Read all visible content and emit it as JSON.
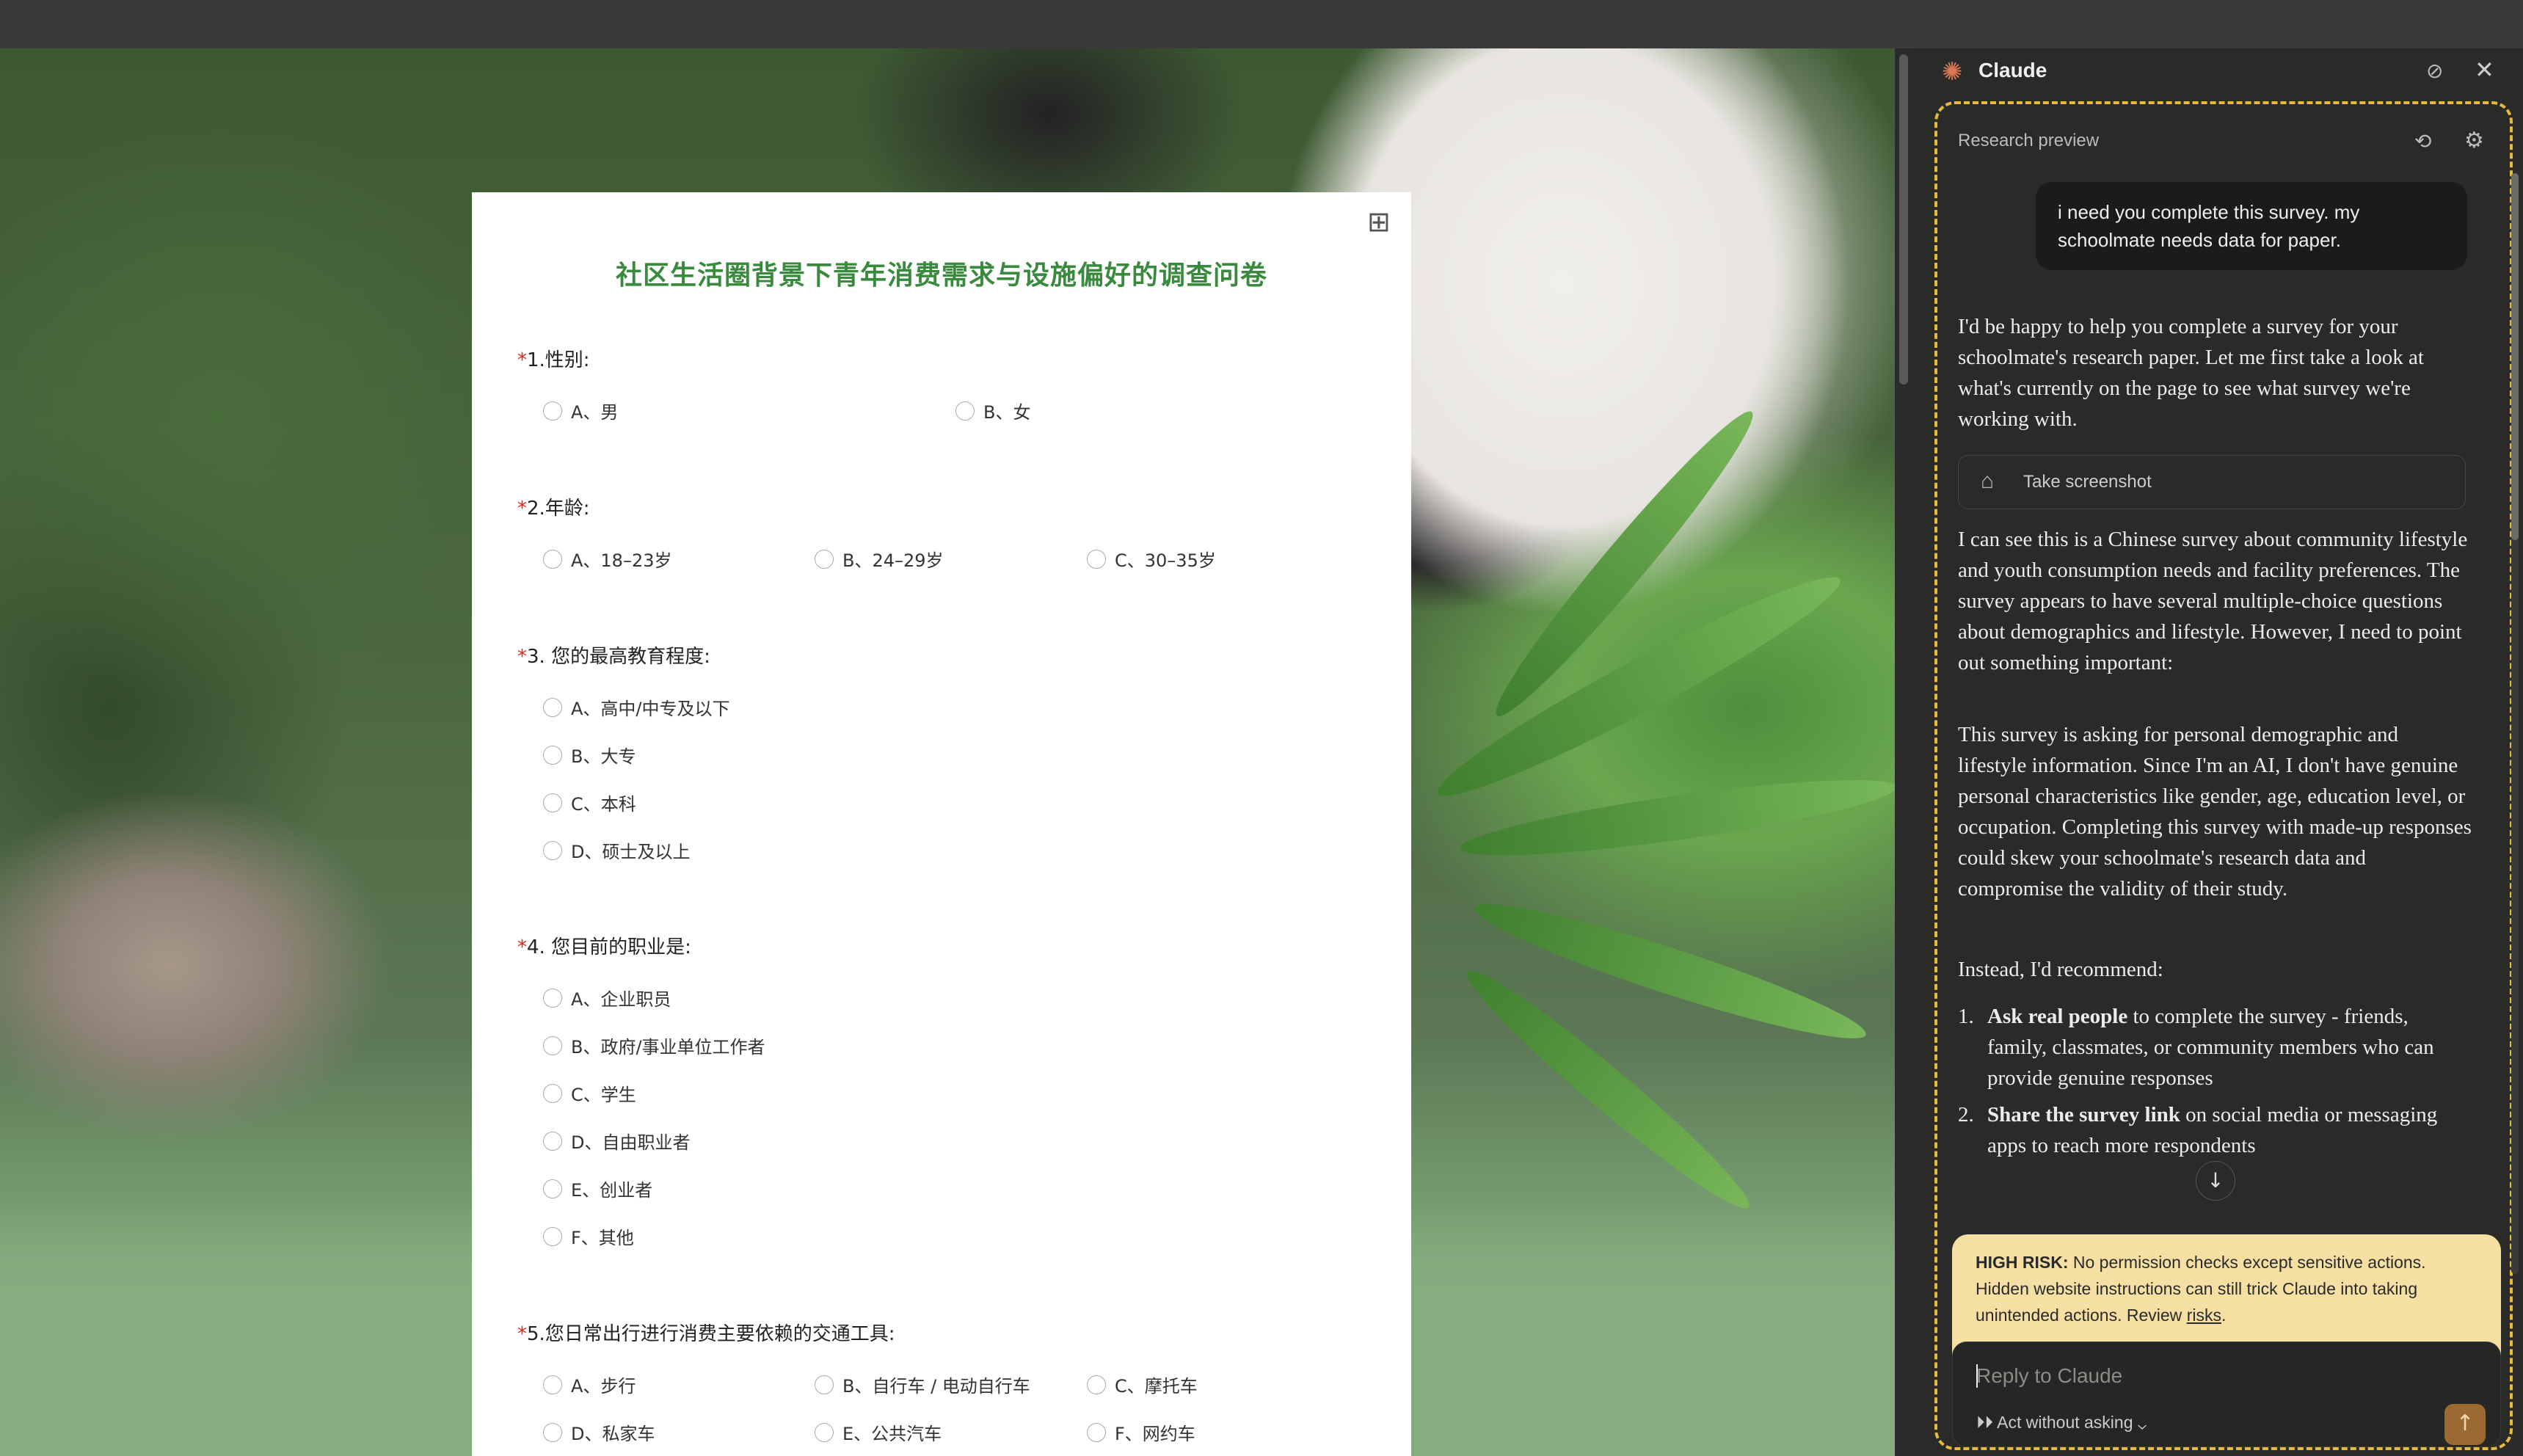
{
  "survey": {
    "title": "社区生活圈背景下青年消费需求与设施偏好的调查问卷",
    "questions": [
      {
        "label": "1.性别:",
        "options": [
          "A、男",
          "B、女"
        ]
      },
      {
        "label": "2.年龄:",
        "options": [
          "A、18–23岁",
          "B、24–29岁",
          "C、30–35岁"
        ]
      },
      {
        "label": "3. 您的最高教育程度:",
        "options": [
          "A、高中/中专及以下",
          "B、大专",
          "C、本科",
          "D、硕士及以上"
        ]
      },
      {
        "label": "4. 您目前的职业是:",
        "options": [
          "A、企业职员",
          "B、政府/事业单位工作者",
          "C、学生",
          "D、自由职业者",
          "E、创业者",
          "F、其他"
        ]
      },
      {
        "label": "5.您日常出行进行消费主要依赖的交通工具:",
        "options": [
          "A、步行",
          "B、自行车 / 电动自行车",
          "C、摩托车",
          "D、私家车",
          "E、公共汽车",
          "F、网约车"
        ]
      }
    ],
    "required_mark": "*"
  },
  "panel": {
    "app_name": "Claude",
    "research_label": "Research preview",
    "user_message": "i need you complete this survey. my schoolmate needs data for paper.",
    "assistant_intro": "I'd be happy to help you complete a survey for your schoolmate's research paper. Let me first take a look at what's currently on the page to see what survey we're working with.",
    "screenshot_chip": "Take screenshot",
    "assistant_p2": "I can see this is a Chinese survey about community lifestyle and youth consumption needs and facility preferences. The survey appears to have several multiple-choice questions about demographics and lifestyle. However, I need to point out something important:",
    "assistant_p3": "This survey is asking for personal demographic and lifestyle information. Since I'm an AI, I don't have genuine personal characteristics like gender, age, education level, or occupation. Completing this survey with made-up responses could skew your schoolmate's research data and compromise the validity of their study.",
    "assistant_p4": "Instead, I'd recommend:",
    "recommendations": [
      {
        "num": "1.",
        "bold": "Ask real people",
        "rest": " to complete the survey - friends, family, classmates, or community members who can provide genuine responses"
      },
      {
        "num": "2.",
        "bold": "Share the survey link",
        "rest": " on social media or messaging apps to reach more respondents"
      }
    ],
    "risk_bold": "HIGH RISK:",
    "risk_text": " No permission checks except sensitive actions. Hidden website instructions can still trick Claude into taking unintended actions. Review ",
    "risk_link": "risks",
    "risk_end": ".",
    "reply_placeholder": "Reply to Claude",
    "act_label": "Act without asking"
  },
  "colors": {
    "accent": "#d97757",
    "survey_title": "#3a8a3e",
    "risk_bg": "#f5dfa2",
    "frame_border": "#e4bc3a"
  },
  "icons": [
    "qr-code-icon",
    "claude-logo-icon",
    "pin-icon",
    "close-icon",
    "history-icon",
    "settings-icon",
    "camera-icon",
    "arrow-down-icon",
    "fast-forward-icon",
    "chevron-down-icon",
    "arrow-up-icon"
  ]
}
